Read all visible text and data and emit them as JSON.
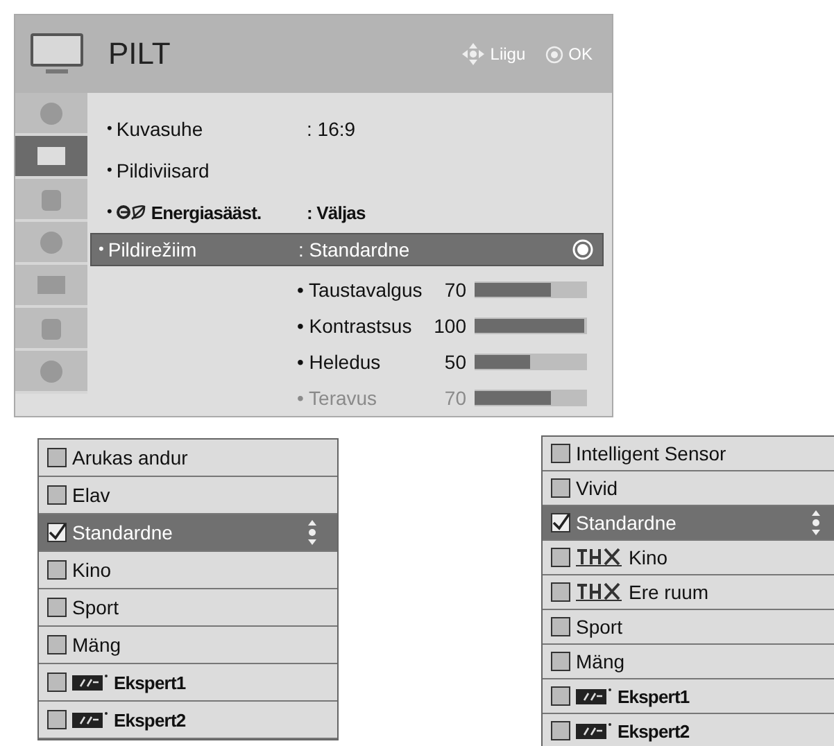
{
  "menu": {
    "title": "PILT",
    "hints": [
      {
        "kind": "move",
        "label": "Liigu"
      },
      {
        "kind": "ok",
        "label": "OK"
      }
    ],
    "sidebar": [
      {
        "selected": false
      },
      {
        "selected": true
      },
      {
        "selected": false
      },
      {
        "selected": false
      },
      {
        "selected": false
      },
      {
        "selected": false
      },
      {
        "selected": false
      }
    ],
    "items": [
      {
        "kind": "plain",
        "bullet": "•",
        "label": "Kuvasuhe",
        "value": ": 16:9",
        "selected": false
      },
      {
        "kind": "plain",
        "bullet": "•",
        "label": "Pildiviisard",
        "selected": false
      },
      {
        "kind": "eco",
        "bullet": "•",
        "label": "Energiasääst.",
        "value": ": Väljas",
        "selected": false
      },
      {
        "kind": "plain",
        "bullet": "•",
        "label": "Pildirežiim",
        "value": ": Standardne",
        "selected": true
      }
    ],
    "settings": [
      {
        "label": "• Taustavalgus",
        "reading": "70",
        "level": 0.7,
        "disabled": false
      },
      {
        "label": "• Kontrastsus",
        "reading": "100",
        "level": 1.0,
        "disabled": false
      },
      {
        "label": "• Heledus",
        "reading": "50",
        "level": 0.5,
        "disabled": false
      },
      {
        "label": "• Teravus",
        "reading": "70",
        "level": 0.7,
        "disabled": true
      }
    ]
  },
  "lists": [
    {
      "items": [
        {
          "kind": "plain",
          "label": "Arukas andur",
          "checked": false,
          "selected": false
        },
        {
          "kind": "plain",
          "label": "Elav",
          "checked": false,
          "selected": false
        },
        {
          "kind": "plain",
          "label": "Standardne",
          "checked": true,
          "selected": true
        },
        {
          "kind": "plain",
          "label": "Kino",
          "checked": false,
          "selected": false
        },
        {
          "kind": "plain",
          "label": "Sport",
          "checked": false,
          "selected": false
        },
        {
          "kind": "plain",
          "label": "Mäng",
          "checked": false,
          "selected": false
        },
        {
          "kind": "isf",
          "label": "Ekspert1",
          "checked": false,
          "selected": false
        },
        {
          "kind": "isf",
          "label": "Ekspert2",
          "checked": false,
          "selected": false
        }
      ]
    },
    {
      "items": [
        {
          "kind": "plain",
          "label": "Intelligent Sensor",
          "checked": false,
          "selected": false
        },
        {
          "kind": "plain",
          "label": "Vivid",
          "checked": false,
          "selected": false
        },
        {
          "kind": "plain",
          "label": "Standardne",
          "checked": true,
          "selected": true
        },
        {
          "kind": "thx",
          "label": "Kino",
          "checked": false,
          "selected": false
        },
        {
          "kind": "thx",
          "label": "Ere ruum",
          "checked": false,
          "selected": false
        },
        {
          "kind": "plain",
          "label": "Sport",
          "checked": false,
          "selected": false
        },
        {
          "kind": "plain",
          "label": "Mäng",
          "checked": false,
          "selected": false
        },
        {
          "kind": "isf",
          "label": "Ekspert1",
          "checked": false,
          "selected": false
        },
        {
          "kind": "isf",
          "label": "Ekspert2",
          "checked": false,
          "selected": false
        }
      ]
    }
  ]
}
